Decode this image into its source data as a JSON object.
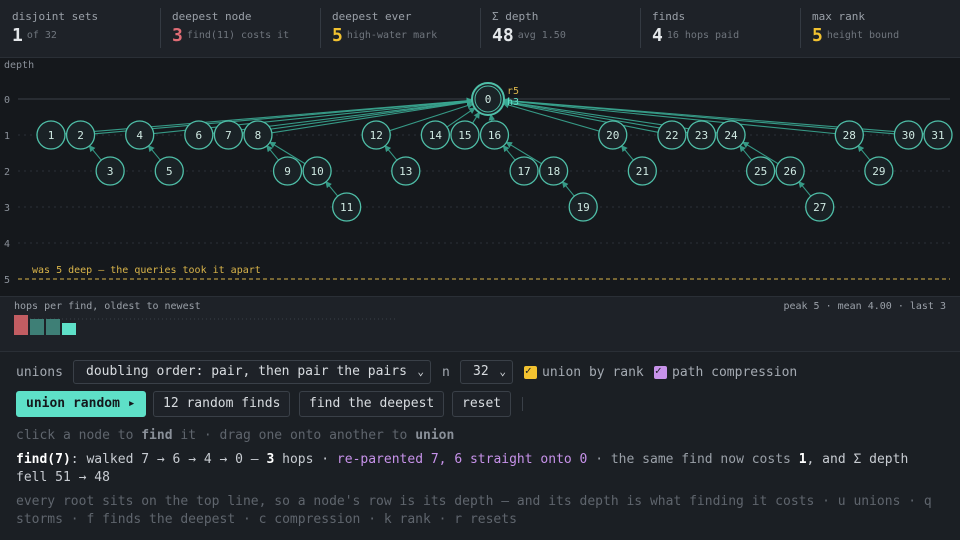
{
  "stats": [
    {
      "label": "disjoint sets",
      "value": "1",
      "sub": "of 32",
      "tone": "normal"
    },
    {
      "label": "deepest node",
      "value": "3",
      "sub": "find(11) costs it",
      "tone": "red"
    },
    {
      "label": "deepest ever",
      "value": "5",
      "sub": "high-water mark",
      "tone": "yellow"
    },
    {
      "label": "Σ depth",
      "value": "48",
      "sub": "avg 1.50",
      "tone": "normal"
    },
    {
      "label": "finds",
      "value": "4",
      "sub": "16 hops paid",
      "tone": "normal"
    },
    {
      "label": "max rank",
      "value": "5",
      "sub": "height bound",
      "tone": "yellow"
    }
  ],
  "tree": {
    "axis_title": "depth",
    "depth_labels": [
      "0",
      "1",
      "2",
      "3",
      "4",
      "5"
    ],
    "high_water_depth": 5,
    "high_water_label": "was 5 deep — the queries took it apart",
    "root": {
      "id": "0",
      "rank_label": "r5",
      "height_label": "h3"
    },
    "nodes": [
      {
        "id": "0",
        "parent": null,
        "depth": 0
      },
      {
        "id": "1",
        "parent": "0",
        "depth": 1
      },
      {
        "id": "2",
        "parent": "0",
        "depth": 1
      },
      {
        "id": "3",
        "parent": "2",
        "depth": 2
      },
      {
        "id": "4",
        "parent": "0",
        "depth": 1
      },
      {
        "id": "5",
        "parent": "4",
        "depth": 2
      },
      {
        "id": "6",
        "parent": "0",
        "depth": 1
      },
      {
        "id": "7",
        "parent": "0",
        "depth": 1
      },
      {
        "id": "8",
        "parent": "0",
        "depth": 1
      },
      {
        "id": "9",
        "parent": "8",
        "depth": 2
      },
      {
        "id": "10",
        "parent": "8",
        "depth": 2
      },
      {
        "id": "11",
        "parent": "10",
        "depth": 3
      },
      {
        "id": "12",
        "parent": "0",
        "depth": 1
      },
      {
        "id": "13",
        "parent": "12",
        "depth": 2
      },
      {
        "id": "14",
        "parent": "0",
        "depth": 1
      },
      {
        "id": "15",
        "parent": "0",
        "depth": 1
      },
      {
        "id": "16",
        "parent": "0",
        "depth": 1
      },
      {
        "id": "17",
        "parent": "16",
        "depth": 2
      },
      {
        "id": "18",
        "parent": "16",
        "depth": 2
      },
      {
        "id": "19",
        "parent": "18",
        "depth": 3
      },
      {
        "id": "20",
        "parent": "0",
        "depth": 1
      },
      {
        "id": "21",
        "parent": "20",
        "depth": 2
      },
      {
        "id": "22",
        "parent": "0",
        "depth": 1
      },
      {
        "id": "23",
        "parent": "0",
        "depth": 1
      },
      {
        "id": "24",
        "parent": "0",
        "depth": 1
      },
      {
        "id": "25",
        "parent": "24",
        "depth": 2
      },
      {
        "id": "26",
        "parent": "24",
        "depth": 2
      },
      {
        "id": "27",
        "parent": "26",
        "depth": 3
      },
      {
        "id": "28",
        "parent": "0",
        "depth": 1
      },
      {
        "id": "29",
        "parent": "28",
        "depth": 2
      },
      {
        "id": "30",
        "parent": "0",
        "depth": 1
      },
      {
        "id": "31",
        "parent": "0",
        "depth": 1
      }
    ]
  },
  "hops": {
    "title": "hops per find, oldest to newest",
    "summary": "peak 5 · mean 4.00 · last 3",
    "values": [
      5,
      4,
      4,
      3
    ],
    "capacity": 32
  },
  "controls": {
    "unions_label": "unions",
    "unions_selected": "doubling order: pair, then pair the pairs",
    "n_label": "n",
    "n_selected": "32",
    "union_by_rank_label": "union by rank",
    "path_compression_label": "path compression",
    "union_random_label": "union random ▸",
    "random_finds_label": "12 random finds",
    "find_deepest_label": "find the deepest",
    "reset_label": "reset"
  },
  "hint": {
    "p1": "click a node to ",
    "b1": "find",
    "p2": " it · drag one onto another to ",
    "b2": "union"
  },
  "message": {
    "call": "find(7)",
    "p1": ": walked 7 → 6 → 4 → 0 — ",
    "hops": "3",
    "p2": " hops · ",
    "reparent": "re-parented 7, 6 straight onto 0",
    "p3": " · the same find now costs ",
    "cost": "1",
    "p4": ", and Σ depth fell 51 → 48"
  },
  "help": "every root sits on the top line, so a node's row is its depth — and its depth is what finding it costs · u unions · q storms · f finds the deepest · c compression · k rank · r resets",
  "colors": {
    "accent": "#5ee0c8",
    "node_stroke": "#4fbfa8",
    "edge": "#3aa892",
    "high_water": "#d9b44a",
    "bar_peak": "#c25d62",
    "bar_normal": "#3e7f76",
    "bar_last": "#5ee0c8"
  }
}
